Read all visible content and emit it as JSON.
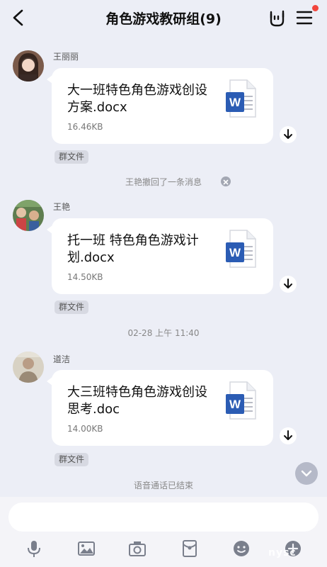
{
  "header": {
    "title": "角色游戏教研组(9)"
  },
  "messages": [
    {
      "sender": "王丽丽",
      "file_name": "大一班特色角色游戏创设方案.docx",
      "file_size": "16.46KB",
      "tag": "群文件"
    },
    {
      "sender": "王艳",
      "file_name": "托一班 特色角色游戏计划.docx",
      "file_size": "14.50KB",
      "tag": "群文件"
    },
    {
      "sender": "道洁",
      "file_name": "大三班特色角色游戏创设思考.doc",
      "file_size": "14.00KB",
      "tag": "群文件"
    }
  ],
  "system": {
    "recall": "王艳撤回了一条消息",
    "timestamp": "02-28 上午 11:40",
    "call_end": "语音通话已结束"
  },
  "icons": {
    "word_letter": "W",
    "word_color": "#2b5cb4"
  },
  "watermark": "nysc"
}
